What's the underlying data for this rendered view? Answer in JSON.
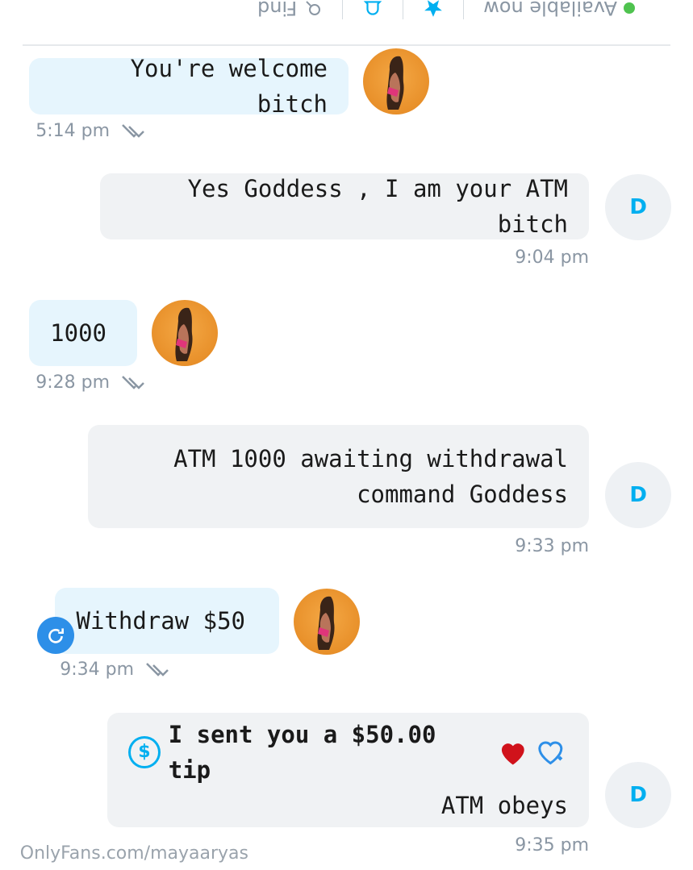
{
  "header": {
    "status_label": "Available now",
    "find_label": "Find"
  },
  "messages": [
    {
      "text": "You're welcome bitch",
      "time": "5:14 pm"
    },
    {
      "text": "Yes Goddess , I am your ATM bitch",
      "time": "9:04 pm",
      "avatar_initial": "D"
    },
    {
      "text": "1000",
      "time": "9:28 pm"
    },
    {
      "line1": "ATM 1000 awaiting withdrawal",
      "line2": "command Goddess",
      "time": "9:33 pm",
      "avatar_initial": "D"
    },
    {
      "text": "Withdraw $50",
      "time": "9:34 pm"
    },
    {
      "tip_text": "I sent you a $50.00 tip",
      "line2": "ATM obeys",
      "time": "9:35 pm",
      "avatar_initial": "D",
      "coin_symbol": "$"
    }
  ],
  "watermark": "OnlyFans.com/mayaaryas",
  "colors": {
    "accent": "#00aff0",
    "incoming_bubble": "#e6f5fd",
    "outgoing_bubble": "#f0f2f4",
    "online": "#4fc34f",
    "heart": "#d0121b"
  }
}
